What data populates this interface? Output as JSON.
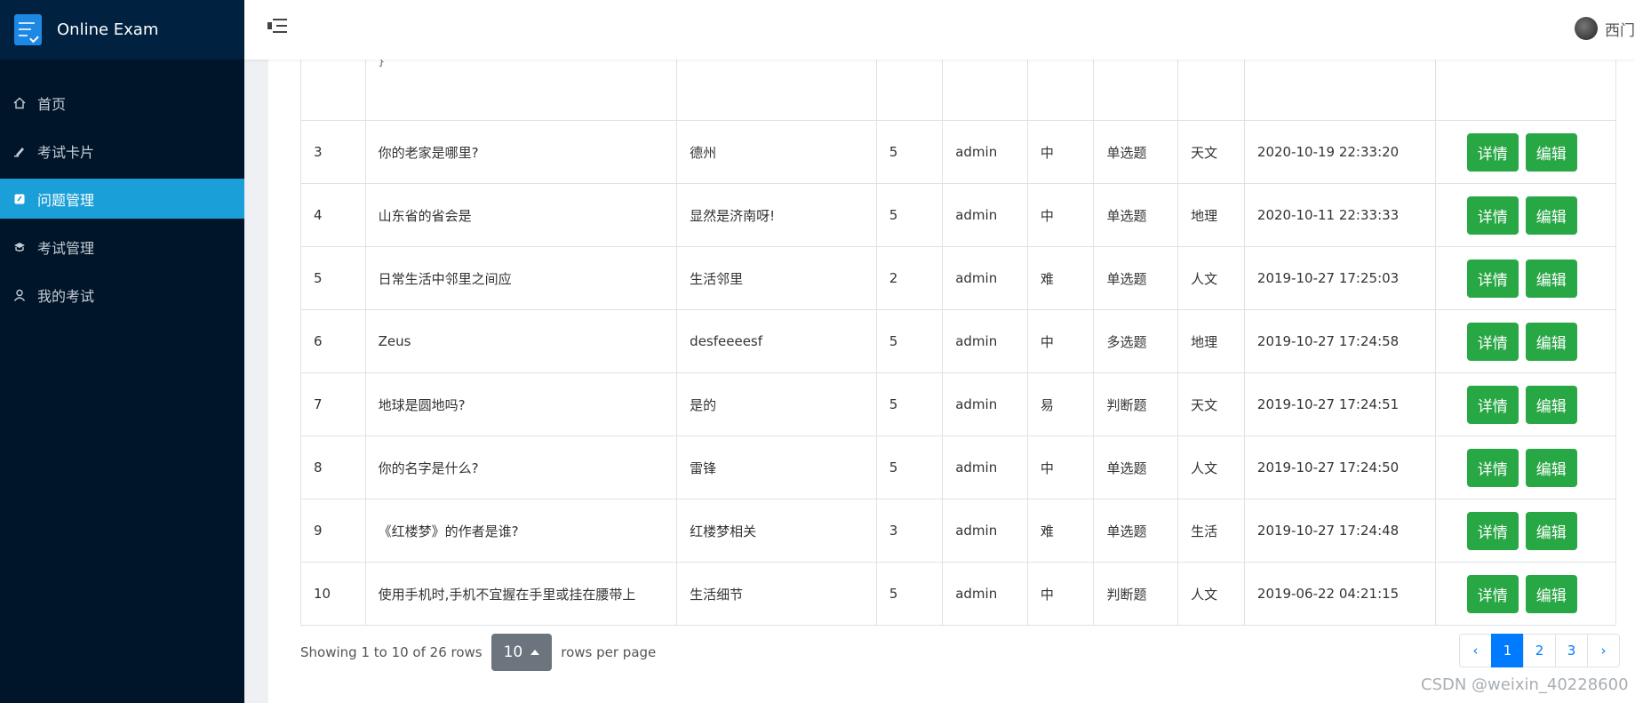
{
  "app": {
    "title": "Online Exam"
  },
  "header": {
    "username": "西门"
  },
  "sidebar": {
    "items": [
      {
        "label": "首页",
        "icon": "home-icon"
      },
      {
        "label": "考试卡片",
        "icon": "card-icon"
      },
      {
        "label": "问题管理",
        "icon": "question-icon",
        "active": true
      },
      {
        "label": "考试管理",
        "icon": "exam-icon"
      },
      {
        "label": "我的考试",
        "icon": "user-icon"
      }
    ]
  },
  "table": {
    "partial_code": "}",
    "actions": {
      "detail": "详情",
      "edit": "编辑"
    },
    "rows": [
      {
        "id": "3",
        "question": "你的老家是哪里?",
        "desc": "德州",
        "score": "5",
        "creator": "admin",
        "level": "中",
        "type": "单选题",
        "category": "天文",
        "time": "2020-10-19 22:33:20"
      },
      {
        "id": "4",
        "question": "山东省的省会是",
        "desc": "显然是济南呀!",
        "score": "5",
        "creator": "admin",
        "level": "中",
        "type": "单选题",
        "category": "地理",
        "time": "2020-10-11 22:33:33"
      },
      {
        "id": "5",
        "question": "日常生活中邻里之间应",
        "desc": "生活邻里",
        "score": "2",
        "creator": "admin",
        "level": "难",
        "type": "单选题",
        "category": "人文",
        "time": "2019-10-27 17:25:03"
      },
      {
        "id": "6",
        "question": "Zeus",
        "desc": "desfeeeesf",
        "score": "5",
        "creator": "admin",
        "level": "中",
        "type": "多选题",
        "category": "地理",
        "time": "2019-10-27 17:24:58"
      },
      {
        "id": "7",
        "question": "地球是圆地吗?",
        "desc": "是的",
        "score": "5",
        "creator": "admin",
        "level": "易",
        "type": "判断题",
        "category": "天文",
        "time": "2019-10-27 17:24:51"
      },
      {
        "id": "8",
        "question": "你的名字是什么?",
        "desc": "雷锋",
        "score": "5",
        "creator": "admin",
        "level": "中",
        "type": "单选题",
        "category": "人文",
        "time": "2019-10-27 17:24:50"
      },
      {
        "id": "9",
        "question": "《红楼梦》的作者是谁?",
        "desc": "红楼梦相关",
        "score": "3",
        "creator": "admin",
        "level": "难",
        "type": "单选题",
        "category": "生活",
        "time": "2019-10-27 17:24:48"
      },
      {
        "id": "10",
        "question": "使用手机时,手机不宜握在手里或挂在腰带上",
        "desc": "生活细节",
        "score": "5",
        "creator": "admin",
        "level": "中",
        "type": "判断题",
        "category": "人文",
        "time": "2019-06-22 04:21:15"
      }
    ]
  },
  "footer": {
    "showing": "Showing 1 to 10 of 26 rows",
    "page_size": "10",
    "rows_per_page": "rows per page",
    "pages": [
      "‹",
      "1",
      "2",
      "3",
      "›"
    ],
    "active_page": "1"
  },
  "watermark": "CSDN @weixin_40228600",
  "colors": {
    "sidebar": "#001529",
    "active": "#1a9fd9",
    "success": "#28a745",
    "primary": "#007bff"
  }
}
